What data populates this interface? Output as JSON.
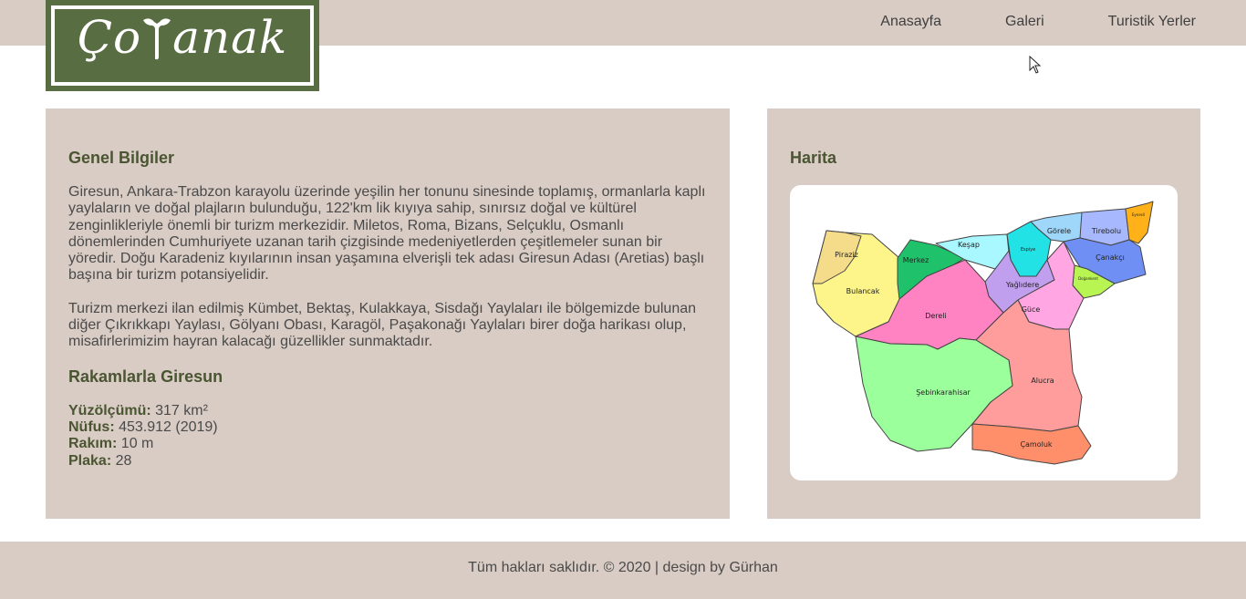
{
  "brand": {
    "logo_text_left": "Ço",
    "logo_text_right": "anak"
  },
  "nav": {
    "items": [
      {
        "label": "Anasayfa"
      },
      {
        "label": "Galeri"
      },
      {
        "label": "Turistik Yerler"
      }
    ]
  },
  "info": {
    "title": "Genel Bilgiler",
    "paragraph1": "Giresun, Ankara-Trabzon karayolu üzerinde yeşilin her tonunu sinesinde toplamış, ormanlarla kaplı yaylaların ve doğal plajların bulunduğu, 122'km lik kıyıya sahip, sınırsız doğal ve kültürel zenginlikleriyle önemli bir turizm merkezidir. Miletos, Roma, Bizans, Selçuklu, Osmanlı dönemlerinden Cumhuriyete uzanan tarih çizgisinde medeniyetlerden çeşitlemeler sunan bir yöredir. Doğu Karadeniz kıyılarının insan yaşamına elverişli tek adası Giresun Adası (Aretias) başlı başına bir turizm potansiyelidir.",
    "paragraph2": "Turizm merkezi ilan edilmiş Kümbet, Bektaş, Kulakkaya, Sisdağı Yaylaları ile bölgemizde bulunan diğer Çıkrıkkapı Yaylası, Gölyanı Obası, Karagöl, Paşakonağı Yaylaları birer doğa harikası olup, misafirlerimizim hayran kalacağı güzellikler sunmaktadır.",
    "stats_title": "Rakamlarla Giresun",
    "stats": [
      {
        "label": "Yüzölçümü:",
        "value": " 317 km²"
      },
      {
        "label": "Nüfus:",
        "value": " 453.912 (2019)"
      },
      {
        "label": "Rakım:",
        "value": " 10 m"
      },
      {
        "label": "Plaka:",
        "value": " 28"
      }
    ]
  },
  "map": {
    "title": "Harita",
    "districts": {
      "piraziz": "Piraziz",
      "merkez": "Merkez",
      "kesap": "Keşap",
      "espiye": "Espiye",
      "gorele": "Görele",
      "tirebolu": "Tirebolu",
      "eynesil": "Eynesil",
      "canakci": "Çanakçı",
      "bulancak": "Bulancak",
      "yagdere": "Yağlıdere",
      "dogankent": "Doğankent",
      "dereli": "Dereli",
      "guce": "Güce",
      "sebinkarahisar": "Şebinkarahisar",
      "alucra": "Alucra",
      "camoluk": "Çamoluk"
    }
  },
  "footer": {
    "text": "Tüm hakları saklıdır. © 2020 | design by Gürhan"
  },
  "colors": {
    "bar": "#d9ccc4",
    "logo_bg": "#596d43",
    "heading": "#4a5532"
  }
}
